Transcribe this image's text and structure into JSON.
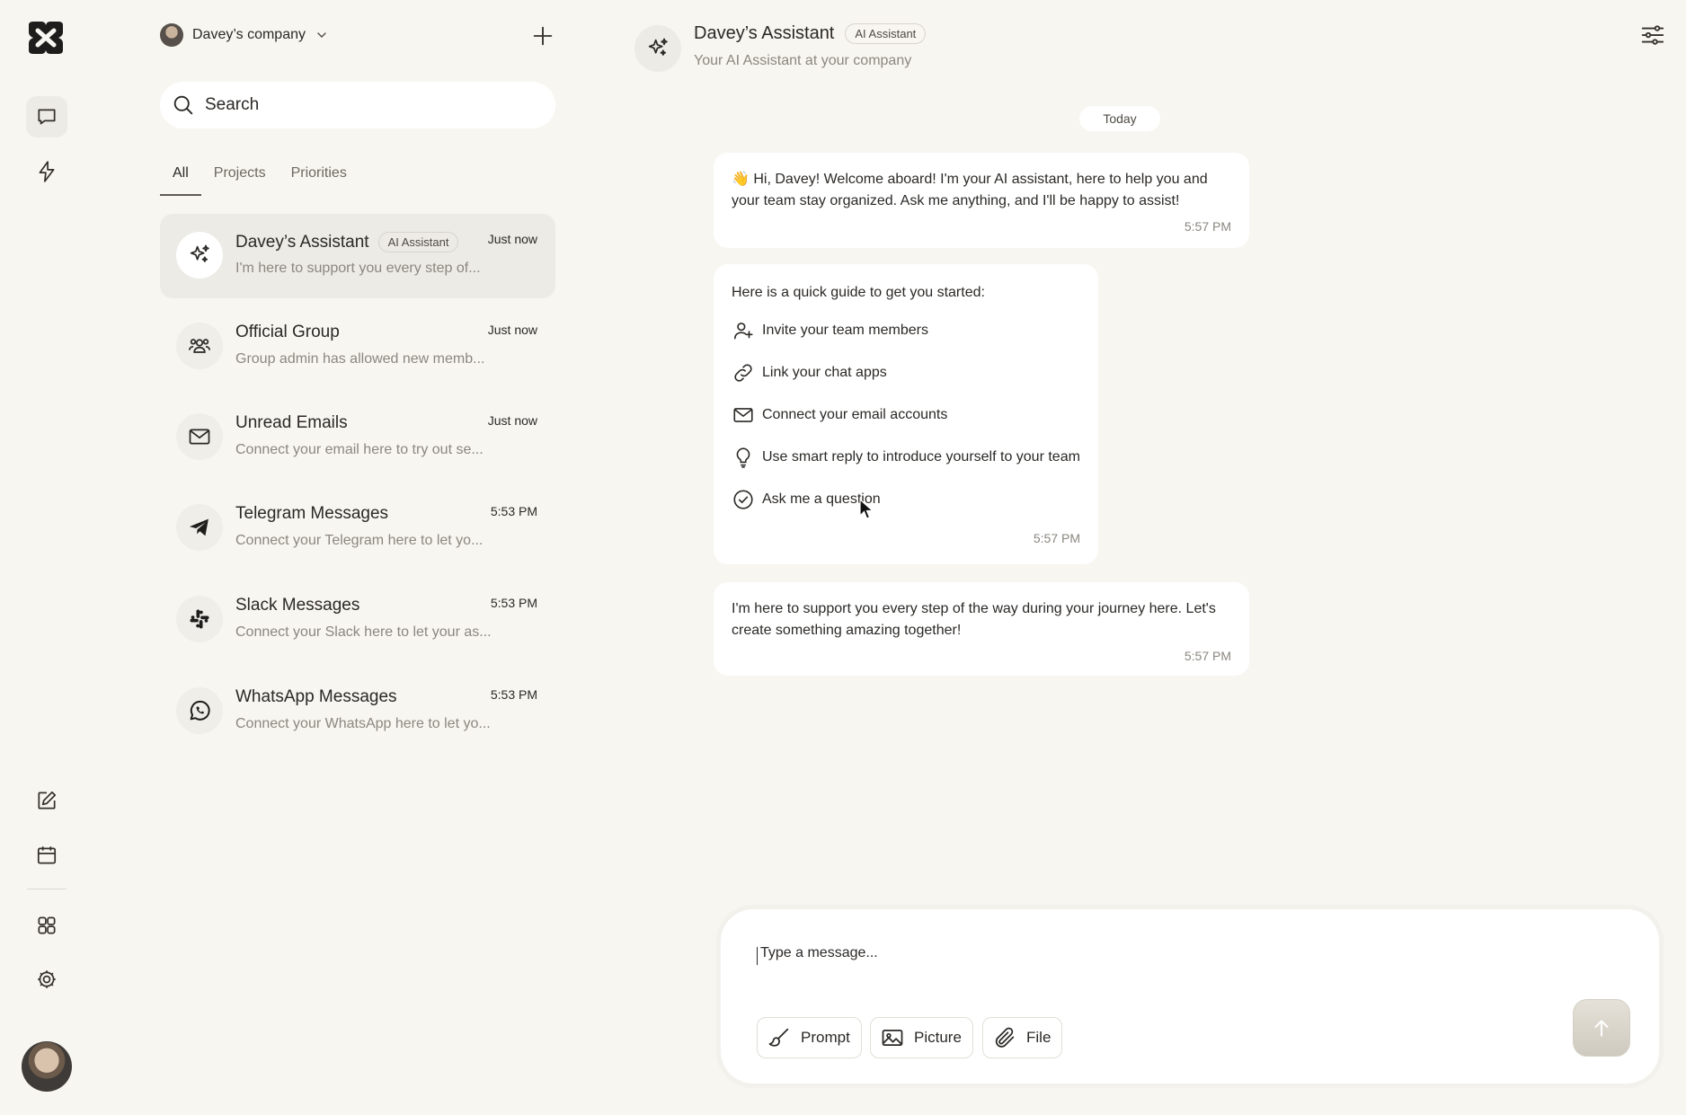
{
  "rail": {
    "items": [
      {
        "name": "chat",
        "icon": "chat-bubble-icon",
        "active": true
      },
      {
        "name": "automations",
        "icon": "lightning-icon",
        "active": false
      }
    ],
    "bottom_items": [
      {
        "name": "compose",
        "icon": "edit-icon"
      },
      {
        "name": "calendar",
        "icon": "calendar-icon"
      },
      {
        "name": "apps",
        "icon": "grid-icon"
      },
      {
        "name": "settings",
        "icon": "gear-icon"
      }
    ]
  },
  "list": {
    "company": "Davey’s company",
    "search_placeholder": "Search",
    "tabs": [
      {
        "label": "All",
        "active": true
      },
      {
        "label": "Projects",
        "active": false
      },
      {
        "label": "Priorities",
        "active": false
      }
    ],
    "chats": [
      {
        "name": "Davey’s Assistant",
        "badge": "AI Assistant",
        "time": "Just now",
        "preview": "I'm here to support you every step of...",
        "icon": "sparkles-icon",
        "active": true
      },
      {
        "name": "Official Group",
        "badge": "",
        "time": "Just now",
        "preview": "Group admin has allowed new memb...",
        "icon": "group-icon",
        "active": false
      },
      {
        "name": "Unread Emails",
        "badge": "",
        "time": "Just now",
        "preview": "Connect your email here to try out se...",
        "icon": "mail-icon",
        "active": false
      },
      {
        "name": "Telegram Messages",
        "badge": "",
        "time": "5:53 PM",
        "preview": "Connect your Telegram here to let yo...",
        "icon": "telegram-icon",
        "active": false
      },
      {
        "name": "Slack Messages",
        "badge": "",
        "time": "5:53 PM",
        "preview": "Connect your Slack here to let your as...",
        "icon": "slack-icon",
        "active": false
      },
      {
        "name": "WhatsApp Messages",
        "badge": "",
        "time": "5:53 PM",
        "preview": "Connect your WhatsApp here to let yo...",
        "icon": "whatsapp-icon",
        "active": false
      }
    ]
  },
  "chat": {
    "title": "Davey’s Assistant",
    "badge": "AI Assistant",
    "subtitle": "Your AI Assistant at your company",
    "day": "Today",
    "messages": {
      "welcome": {
        "emoji": "👋",
        "text": "Hi, Davey! Welcome aboard! I'm your AI assistant, here to help you and your team stay organized. Ask me anything, and I'll be happy to assist!",
        "time": "5:57 PM"
      },
      "guide": {
        "intro": "Here is a quick guide to get you started:",
        "items": [
          {
            "label": "Invite your team members",
            "icon": "add-user-icon"
          },
          {
            "label": "Link your chat apps",
            "icon": "link-icon"
          },
          {
            "label": "Connect your email accounts",
            "icon": "mail-icon"
          },
          {
            "label": "Use smart reply to introduce yourself to your team",
            "icon": "lightbulb-icon"
          },
          {
            "label": "Ask me a question",
            "icon": "check-circle-icon"
          }
        ],
        "time": "5:57 PM"
      },
      "support": {
        "text": "I'm here to support you every step of the way during your journey here. Let's create something amazing together!",
        "time": "5:57 PM"
      }
    }
  },
  "composer": {
    "placeholder": "Type a message...",
    "prompt_label": "Prompt",
    "picture_label": "Picture",
    "file_label": "File"
  },
  "colors": {
    "background": "#f8f6f1",
    "surface": "#ffffff",
    "active_item": "#ecebe6",
    "muted_text": "#8b8780"
  }
}
